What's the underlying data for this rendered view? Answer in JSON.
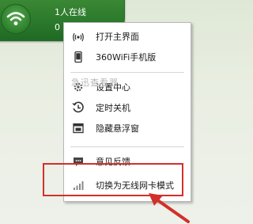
{
  "widget": {
    "online_text": "1人在线",
    "count_text": "0",
    "wifi_icon": "wifi-icon",
    "color": "#2c7a2c"
  },
  "menu": {
    "items": [
      {
        "label": "打开主界面",
        "icon": "wifi-signal-icon"
      },
      {
        "label": "360WiFi手机版",
        "icon": "phone-icon"
      },
      {
        "label": "设置中心",
        "icon": "gear-icon"
      },
      {
        "label": "定时关机",
        "icon": "clock-icon"
      },
      {
        "label": "隐藏悬浮窗",
        "icon": "hide-window-icon"
      },
      {
        "label": "意见反馈",
        "icon": "feedback-icon"
      },
      {
        "label": "切换为无线网卡模式",
        "icon": "signal-bars-icon"
      }
    ]
  },
  "watermark": "急迅查看器",
  "annotation_color": "#d2302a"
}
